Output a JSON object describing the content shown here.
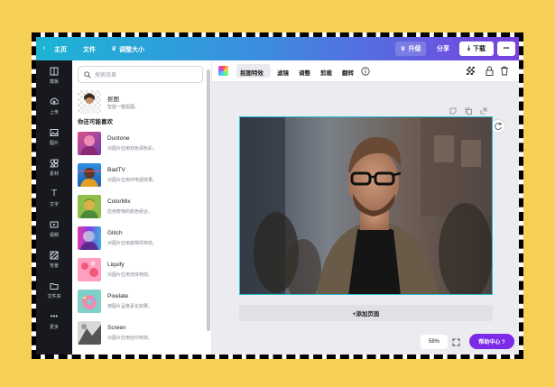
{
  "topbar": {
    "back_label": "主页",
    "file_label": "文件",
    "resize_label": "调整大小",
    "upgrade_label": "升级",
    "share_label": "分享",
    "download_label": "下载",
    "more_label": "•••"
  },
  "rail": [
    {
      "label": "模板",
      "icon": "template-icon"
    },
    {
      "label": "上传",
      "icon": "upload-icon"
    },
    {
      "label": "图片",
      "icon": "image-icon"
    },
    {
      "label": "素材",
      "icon": "elements-icon"
    },
    {
      "label": "文字",
      "icon": "text-icon"
    },
    {
      "label": "视频",
      "icon": "video-icon"
    },
    {
      "label": "背景",
      "icon": "background-icon"
    },
    {
      "label": "文件夹",
      "icon": "folder-icon"
    },
    {
      "label": "更多",
      "icon": "more-icon"
    }
  ],
  "panel": {
    "search_placeholder": "搜索效果",
    "cutout": {
      "name": "抠图",
      "desc": "智能一键抠图。"
    },
    "section_title": "你还可能喜欢",
    "effects": [
      {
        "name": "Duotone",
        "desc": "对图片应用双色调色彩。"
      },
      {
        "name": "BadTV",
        "desc": "对图片应用坏电视效果。"
      },
      {
        "name": "ColorMix",
        "desc": "应用奇特的颜色组合。"
      },
      {
        "name": "Glitch",
        "desc": "对图片应用故障风特效。"
      },
      {
        "name": "Liquify",
        "desc": "对图片应用流体特效。"
      },
      {
        "name": "Pixelate",
        "desc": "使图片呈像素化效果。"
      },
      {
        "name": "Screen",
        "desc": "对图片应用丝印特效。"
      }
    ]
  },
  "editor": {
    "tools": [
      "抠图特效",
      "滤镜",
      "调整",
      "剪裁",
      "翻转"
    ],
    "add_page_label": "+添加页面",
    "zoom_label": "58%",
    "help_label": "帮助中心 ?"
  },
  "colors": {
    "accent": "#7d2ae8",
    "rail_bg": "#17191f",
    "selection": "#2bc0d8"
  }
}
